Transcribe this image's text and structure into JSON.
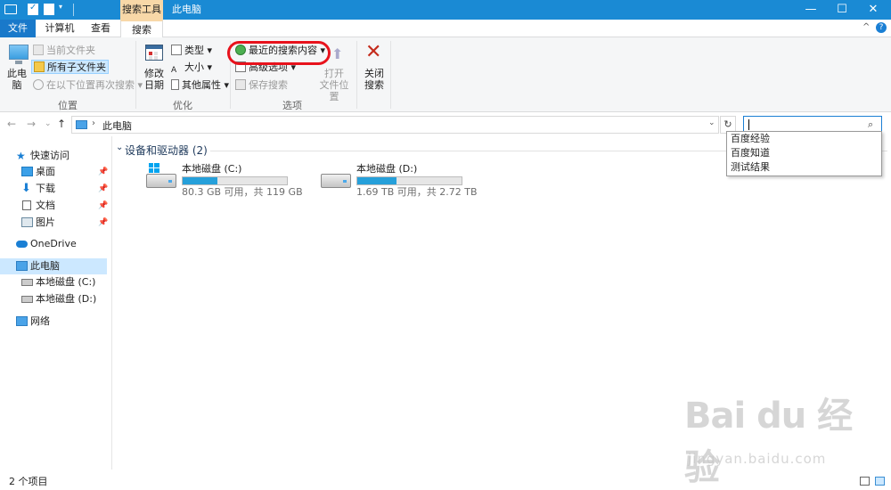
{
  "window": {
    "title": "此电脑",
    "context_tab": "搜索工具"
  },
  "window_buttons": {
    "minimize": "—",
    "maximize": "☐",
    "close": "✕"
  },
  "tabs": {
    "file": "文件",
    "computer": "计算机",
    "view": "查看",
    "search": "搜索"
  },
  "ribbon": {
    "location": {
      "this_pc": "此电\n脑",
      "current_folder": "当前文件夹",
      "all_subfolders": "所有子文件夹",
      "search_again_in": "在以下位置再次搜索",
      "group_label": "位置"
    },
    "refine": {
      "date_modified": "修改\n日期",
      "kind": "类型",
      "size": "大小",
      "other_properties": "其他属性",
      "group_label": "优化"
    },
    "options": {
      "recent_searches": "最近的搜索内容",
      "advanced_options": "高级选项",
      "save_search": "保存搜索",
      "open_file_location": "打开\n文件位置",
      "group_label": "选项"
    },
    "close": {
      "label": "关闭\n搜索"
    }
  },
  "address": {
    "path": "此电脑",
    "search_value": ""
  },
  "search_suggestions": [
    "百度经验",
    "百度知道",
    "测试结果"
  ],
  "sidebar": {
    "quick_access": "快速访问",
    "desktop": "桌面",
    "downloads": "下载",
    "documents": "文档",
    "pictures": "图片",
    "onedrive": "OneDrive",
    "this_pc": "此电脑",
    "drive_c": "本地磁盘 (C:)",
    "drive_d": "本地磁盘 (D:)",
    "network": "网络"
  },
  "content": {
    "section_title": "设备和驱动器 (2)",
    "drives": [
      {
        "name": "本地磁盘 (C:)",
        "info": "80.3 GB 可用，共 119 GB",
        "used_fraction": 0.33
      },
      {
        "name": "本地磁盘 (D:)",
        "info": "1.69 TB 可用，共 2.72 TB",
        "used_fraction": 0.38
      }
    ]
  },
  "status": {
    "count": "2 个项目"
  },
  "watermark": {
    "logo": "Bai du 经验",
    "url": "jingyan.baidu.com"
  },
  "colors": {
    "titlebar": "#1a8ad4",
    "file_tab": "#1979ca",
    "annotation": "#e8121c",
    "drive_fill": "#26a0da"
  }
}
